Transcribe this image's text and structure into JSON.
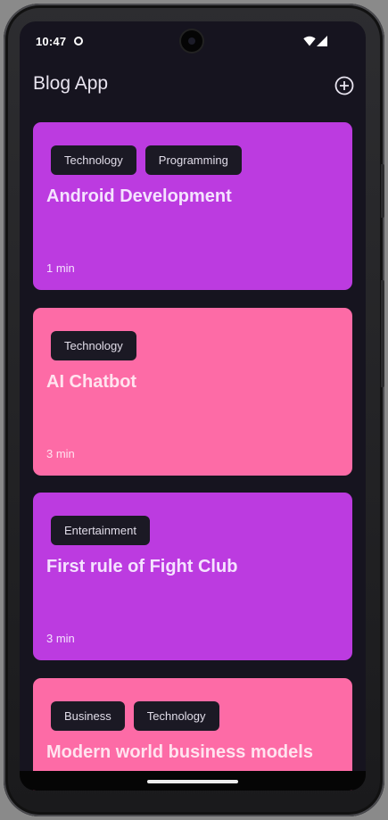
{
  "status_bar": {
    "time": "10:47"
  },
  "app": {
    "title": "Blog App",
    "add_icon": "add-circle-icon"
  },
  "colors": {
    "background": "#16141f",
    "tag_background": "#1b1924",
    "card_purple": "#bc3be0",
    "card_pink": "#fd6ba6"
  },
  "posts": [
    {
      "tags": [
        "Technology",
        "Programming"
      ],
      "title": "Android Development",
      "read_time": "1 min",
      "color": "#bc3be0",
      "text_color": "#f5e3ff"
    },
    {
      "tags": [
        "Technology"
      ],
      "title": "AI Chatbot",
      "read_time": "3 min",
      "color": "#fd6ba6",
      "text_color": "#ffe3ef"
    },
    {
      "tags": [
        "Entertainment"
      ],
      "title": "First rule of Fight Club",
      "read_time": "3 min",
      "color": "#bc3be0",
      "text_color": "#f5e3ff"
    },
    {
      "tags": [
        "Business",
        "Technology"
      ],
      "title": "Modern world business models",
      "read_time": "",
      "color": "#fd6ba6",
      "text_color": "#ffe3ef"
    }
  ]
}
